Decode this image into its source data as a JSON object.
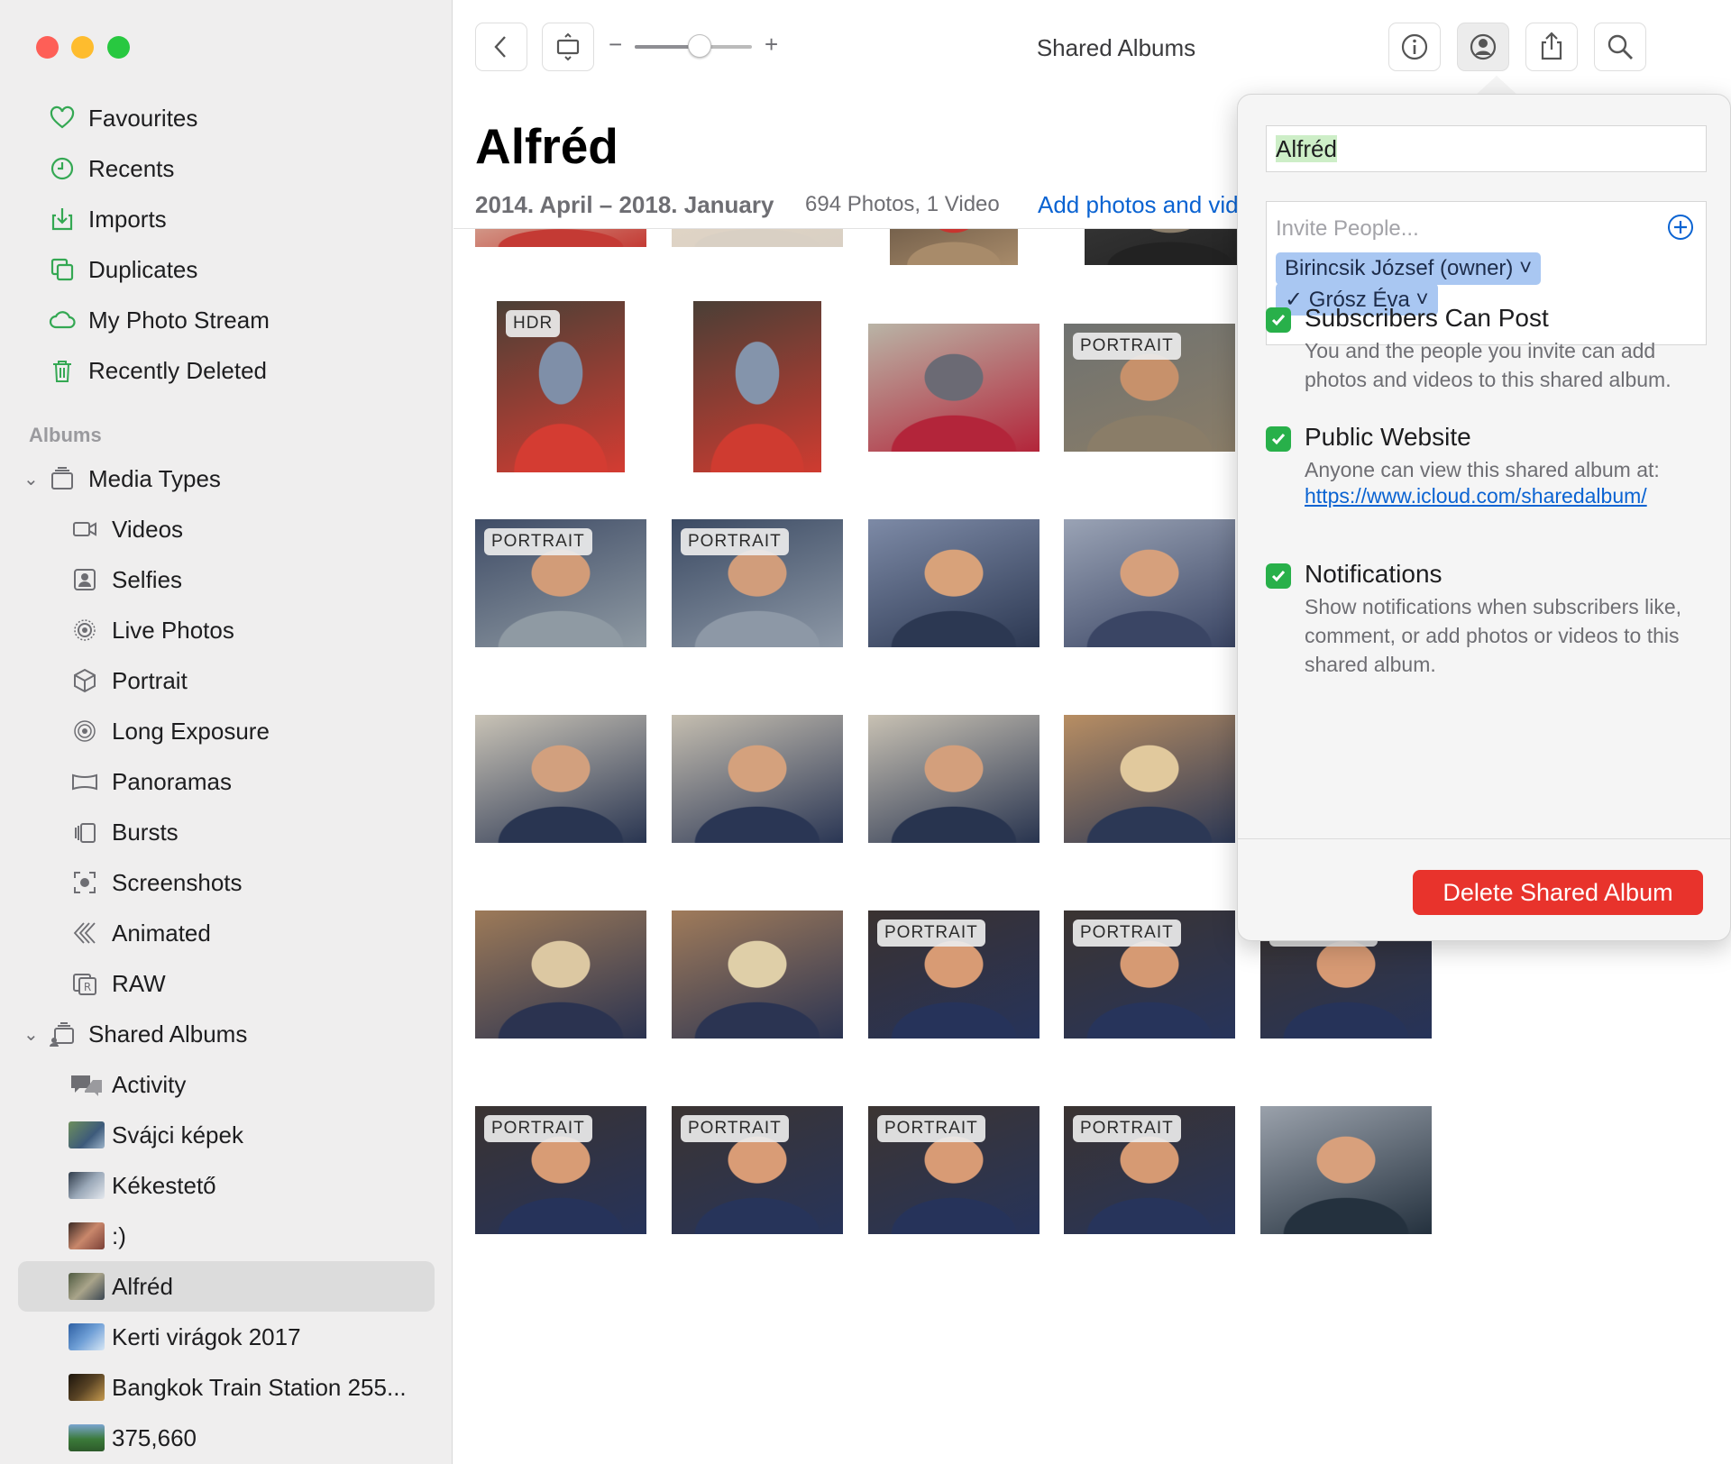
{
  "window": {
    "title": "Shared Albums",
    "traffic_lights": [
      "#fe5f57",
      "#febc2e",
      "#28c840"
    ]
  },
  "sidebar": {
    "library": [
      {
        "label": "Favourites",
        "icon": "heart-icon"
      },
      {
        "label": "Recents",
        "icon": "clock-icon"
      },
      {
        "label": "Imports",
        "icon": "import-icon"
      },
      {
        "label": "Duplicates",
        "icon": "duplicates-icon"
      },
      {
        "label": "My Photo Stream",
        "icon": "cloud-icon"
      },
      {
        "label": "Recently Deleted",
        "icon": "trash-icon"
      }
    ],
    "albums_header": "Albums",
    "media_types": {
      "label": "Media Types",
      "items": [
        {
          "label": "Videos",
          "icon": "video-icon"
        },
        {
          "label": "Selfies",
          "icon": "selfie-icon"
        },
        {
          "label": "Live Photos",
          "icon": "live-photo-icon"
        },
        {
          "label": "Portrait",
          "icon": "cube-icon"
        },
        {
          "label": "Long Exposure",
          "icon": "long-exposure-icon"
        },
        {
          "label": "Panoramas",
          "icon": "panorama-icon"
        },
        {
          "label": "Bursts",
          "icon": "bursts-icon"
        },
        {
          "label": "Screenshots",
          "icon": "screenshot-icon"
        },
        {
          "label": "Animated",
          "icon": "animated-icon"
        },
        {
          "label": "RAW",
          "icon": "raw-icon"
        }
      ]
    },
    "shared_albums": {
      "label": "Shared Albums",
      "items": [
        {
          "label": "Activity",
          "icon": "activity-icon"
        },
        {
          "label": "Svájci képek",
          "thumb": "#5b7a4e"
        },
        {
          "label": "Kékestető",
          "thumb": "#6f7f93"
        },
        {
          "label": ":)",
          "thumb": "#7b4b3f"
        },
        {
          "label": "Alfréd",
          "thumb": "#66705a",
          "selected": true
        },
        {
          "label": "Kerti virágok 2017",
          "thumb": "#3f6fa8"
        },
        {
          "label": "Bangkok Train Station 255...",
          "thumb": "#2b2418"
        },
        {
          "label": "375,660",
          "thumb": "#3b7a3a"
        }
      ]
    }
  },
  "toolbar": {
    "zoom_minus": "−",
    "zoom_plus": "+",
    "zoom_level": 0.55
  },
  "album": {
    "title": "Alfréd",
    "dates": "2014. April – 2018. January",
    "count": "694 Photos, 1 Video",
    "add_link": "Add photos and videos"
  },
  "photos": [
    {
      "badge": "",
      "colors": [
        "#d9c9b4",
        "#8f6f52",
        "#c43a34"
      ]
    },
    {
      "badge": "",
      "colors": [
        "#e3d6c6",
        "#9c8a78",
        "#d9d0c4"
      ]
    },
    {
      "badge": "",
      "colors": [
        "#5b4b3c",
        "#c7342f",
        "#a88b6a"
      ]
    },
    {
      "badge": "",
      "colors": [
        "#3a3a3a",
        "#8a7d6a",
        "#222222"
      ]
    },
    {
      "badge": "HDR",
      "colors": [
        "#4b4036",
        "#7f8fa8",
        "#d43c32"
      ]
    },
    {
      "badge": "",
      "colors": [
        "#4a3f36",
        "#8494ab",
        "#cf3b30"
      ]
    },
    {
      "badge": "",
      "colors": [
        "#b9b4a6",
        "#6b6a74",
        "#b3253a"
      ]
    },
    {
      "badge": "PORTRAIT",
      "colors": [
        "#6f7270",
        "#c7916b",
        "#8a7d68"
      ]
    },
    {
      "badge": "PORTRAIT",
      "colors": [
        "#3f4c66",
        "#d29c78",
        "#8f9aa3"
      ]
    },
    {
      "badge": "PORTRAIT",
      "colors": [
        "#3b4a63",
        "#d19d7b",
        "#8d98a6"
      ]
    },
    {
      "badge": "",
      "colors": [
        "#7d8aa6",
        "#d8a27a",
        "#2c3852"
      ]
    },
    {
      "badge": "",
      "colors": [
        "#9aa3b5",
        "#d6a07c",
        "#3a4564"
      ]
    },
    {
      "badge": "",
      "colors": [
        "#c9c3b6",
        "#d2a07e",
        "#293551"
      ]
    },
    {
      "badge": "",
      "colors": [
        "#c5beb0",
        "#d4a17d",
        "#2a3654"
      ]
    },
    {
      "badge": "",
      "colors": [
        "#c8c1b3",
        "#d39f7c",
        "#28344f"
      ]
    },
    {
      "badge": "",
      "colors": [
        "#b88e63",
        "#e1c99d",
        "#2c3855"
      ]
    },
    {
      "badge": "",
      "colors": [
        "#b08a60",
        "#e4cfa2",
        "#2c3755"
      ]
    },
    {
      "badge": "",
      "colors": [
        "#9d7a58",
        "#dcc8a2",
        "#2b3350"
      ]
    },
    {
      "badge": "",
      "colors": [
        "#a07b5a",
        "#dfcfa8",
        "#2b3452"
      ]
    },
    {
      "badge": "PORTRAIT",
      "colors": [
        "#3a3230",
        "#d89b74",
        "#26335a"
      ]
    },
    {
      "badge": "PORTRAIT",
      "colors": [
        "#3b3431",
        "#d69a73",
        "#27345b"
      ]
    },
    {
      "badge": "PORTRAIT",
      "colors": [
        "#3c3532",
        "#d79a74",
        "#263359"
      ]
    },
    {
      "badge": "PORTRAIT",
      "colors": [
        "#3a3331",
        "#d89c75",
        "#26335a"
      ]
    },
    {
      "badge": "PORTRAIT",
      "colors": [
        "#3b3432",
        "#d99c76",
        "#27345a"
      ]
    },
    {
      "badge": "PORTRAIT",
      "colors": [
        "#3c3532",
        "#d89b75",
        "#26335a"
      ]
    },
    {
      "badge": "PORTRAIT",
      "colors": [
        "#3a3331",
        "#d69a73",
        "#27345b"
      ]
    },
    {
      "badge": "",
      "colors": [
        "#9aa1ab",
        "#d8a07c",
        "#24313e"
      ]
    }
  ],
  "popover": {
    "album_name": "Alfréd",
    "invite_placeholder": "Invite People...",
    "people": [
      "Birincsik József (owner) ˅",
      "✓ Grósz Éva ˅"
    ],
    "options": [
      {
        "title": "Subscribers Can Post",
        "desc": "You and the people you invite can add photos and videos to this shared album.",
        "checked": true
      },
      {
        "title": "Public Website",
        "desc": "Anyone can view this shared album at:",
        "link": "https://www.icloud.com/sharedalbum/",
        "checked": true
      },
      {
        "title": "Notifications",
        "desc": "Show notifications when subscribers like, comment, or add photos or videos to this shared album.",
        "checked": true
      }
    ],
    "delete_label": "Delete Shared Album"
  },
  "colors": {
    "accent": "#0a63d2",
    "check": "#28b04a",
    "delete": "#e8332c",
    "sidebar_icon": "#34a853"
  }
}
